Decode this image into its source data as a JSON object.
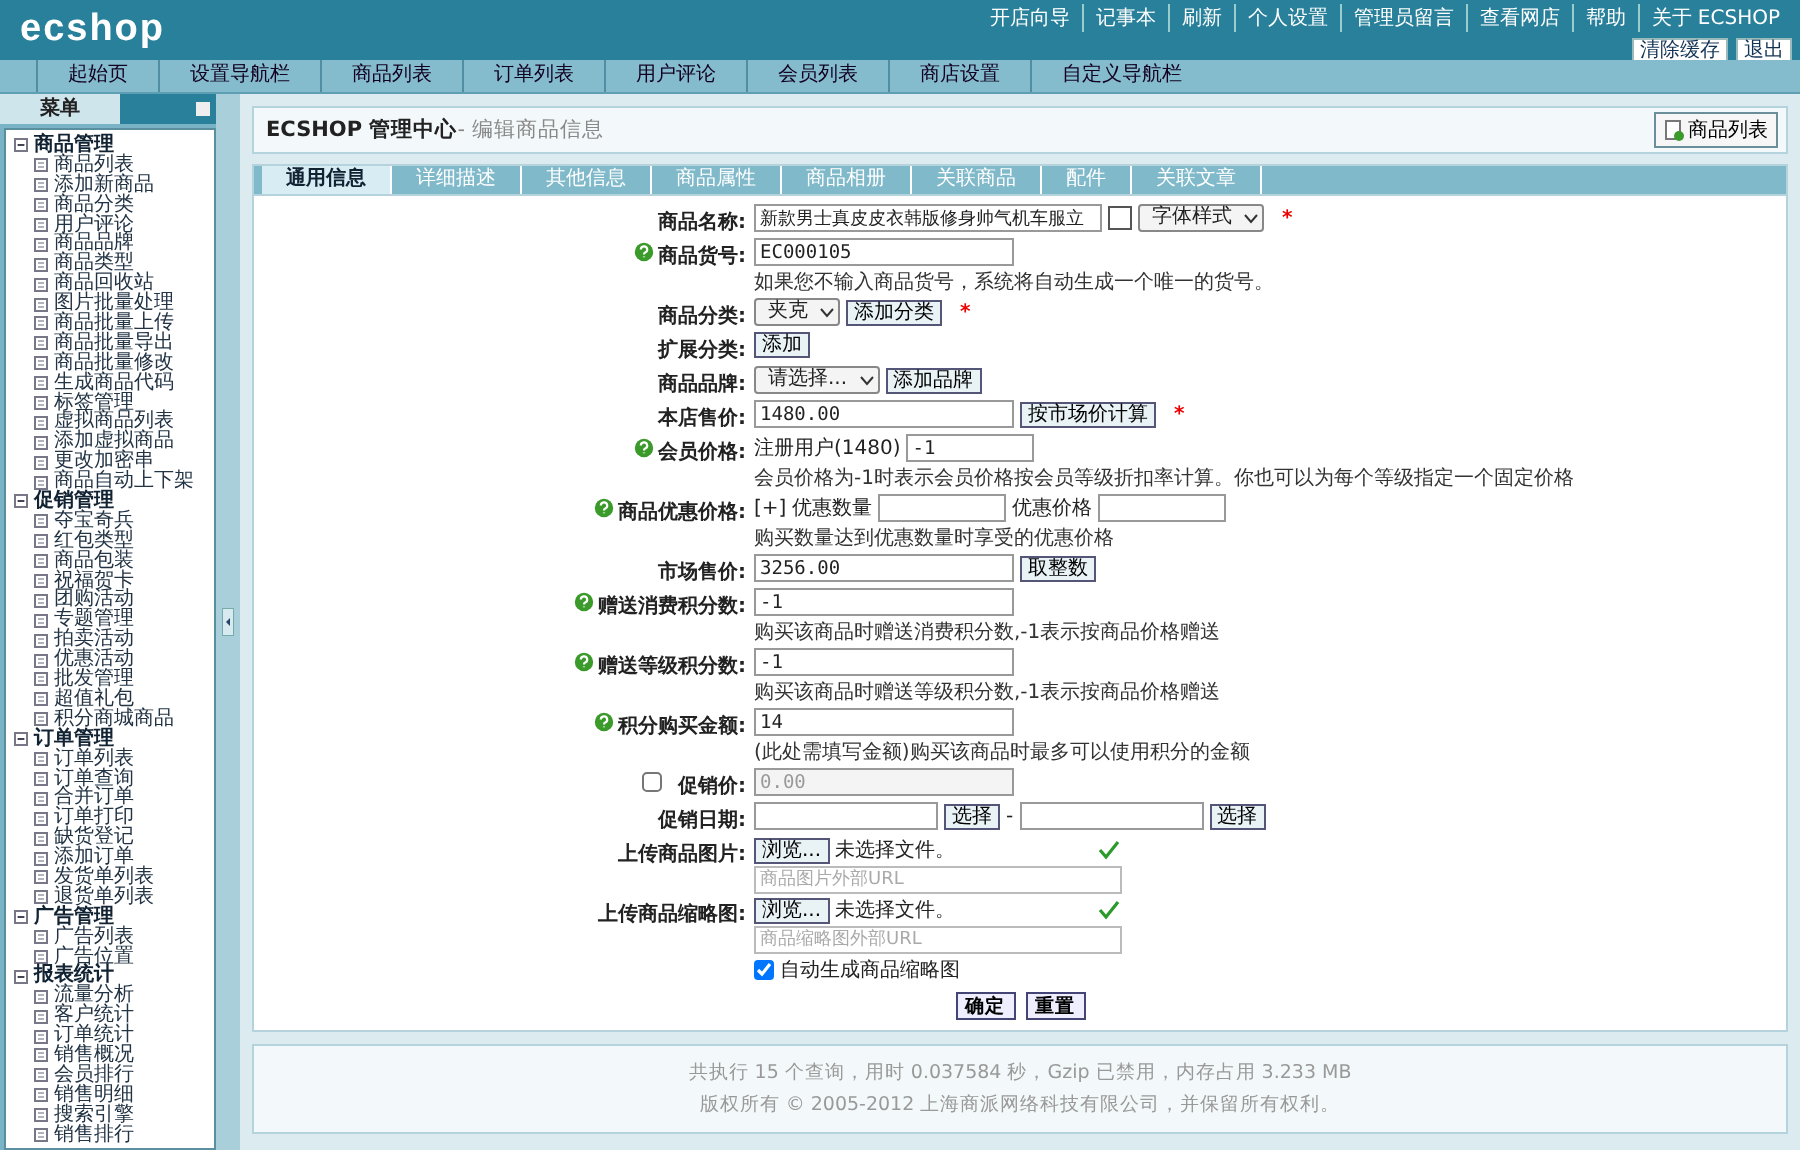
{
  "header": {
    "logo": "ecshop",
    "links": [
      "开店向导",
      "记事本",
      "刷新",
      "个人设置",
      "管理员留言",
      "查看网店",
      "帮助",
      "关于 ECSHOP"
    ],
    "buttons": [
      "清除缓存",
      "退出"
    ]
  },
  "nav": {
    "tabs": [
      {
        "label": "起始页",
        "selected": false
      },
      {
        "label": "设置导航栏",
        "selected": false
      },
      {
        "label": "商品列表",
        "selected": false
      },
      {
        "label": "订单列表",
        "selected": false
      },
      {
        "label": "用户评论",
        "selected": false
      },
      {
        "label": "会员列表",
        "selected": false
      },
      {
        "label": "商店设置",
        "selected": false
      },
      {
        "label": "自定义导航栏",
        "selected": false
      }
    ]
  },
  "sidebar": {
    "tab": "菜单",
    "groups": [
      {
        "label": "商品管理",
        "expanded": true,
        "children": [
          "商品列表",
          "添加新商品",
          "商品分类",
          "用户评论",
          "商品品牌",
          "商品类型",
          "商品回收站",
          "图片批量处理",
          "商品批量上传",
          "商品批量导出",
          "商品批量修改",
          "生成商品代码",
          "标签管理",
          "虚拟商品列表",
          "添加虚拟商品",
          "更改加密串",
          "商品自动上下架"
        ]
      },
      {
        "label": "促销管理",
        "expanded": true,
        "children": [
          "夺宝奇兵",
          "红包类型",
          "商品包装",
          "祝福贺卡",
          "团购活动",
          "专题管理",
          "拍卖活动",
          "优惠活动",
          "批发管理",
          "超值礼包",
          "积分商城商品"
        ]
      },
      {
        "label": "订单管理",
        "expanded": true,
        "children": [
          "订单列表",
          "订单查询",
          "合并订单",
          "订单打印",
          "缺货登记",
          "添加订单",
          "发货单列表",
          "退货单列表"
        ]
      },
      {
        "label": "广告管理",
        "expanded": true,
        "children": [
          "广告列表",
          "广告位置"
        ]
      },
      {
        "label": "报表统计",
        "expanded": true,
        "children": [
          "流量分析",
          "客户统计",
          "订单统计",
          "销售概况",
          "会员排行",
          "销售明细",
          "搜索引擎",
          "销售排行"
        ]
      }
    ]
  },
  "page": {
    "title": "ECSHOP 管理中心",
    "subtitle": "- 编辑商品信息",
    "action": "商品列表"
  },
  "tabs": [
    {
      "label": "通用信息",
      "selected": true
    },
    {
      "label": "详细描述",
      "selected": false
    },
    {
      "label": "其他信息",
      "selected": false
    },
    {
      "label": "商品属性",
      "selected": false
    },
    {
      "label": "商品相册",
      "selected": false
    },
    {
      "label": "关联商品",
      "selected": false
    },
    {
      "label": "配件",
      "selected": false
    },
    {
      "label": "关联文章",
      "selected": false
    }
  ],
  "form": {
    "rows": [
      {
        "label": "商品名称:",
        "lines": [
          [
            {
              "kind": "input-wide",
              "value": "新款男士真皮皮衣韩版修身帅气机车服立"
            },
            {
              "kind": "color"
            },
            {
              "kind": "select",
              "value": "字体样式"
            },
            {
              "kind": "required",
              "text": "*"
            }
          ]
        ]
      },
      {
        "label": "商品货号:",
        "help": true,
        "lines": [
          [
            {
              "kind": "input",
              "value": "EC000105"
            }
          ],
          [
            {
              "kind": "note",
              "text": "如果您不输入商品货号，系统将自动生成一个唯一的货号。"
            }
          ]
        ]
      },
      {
        "label": "商品分类:",
        "lines": [
          [
            {
              "kind": "select",
              "value": "夹克"
            },
            {
              "kind": "button",
              "text": "添加分类"
            },
            {
              "kind": "required",
              "text": "*"
            }
          ]
        ]
      },
      {
        "label": "扩展分类:",
        "lines": [
          [
            {
              "kind": "button",
              "text": "添加"
            }
          ]
        ]
      },
      {
        "label": "商品品牌:",
        "lines": [
          [
            {
              "kind": "select",
              "value": "请选择..."
            },
            {
              "kind": "button",
              "text": "添加品牌"
            }
          ]
        ]
      },
      {
        "label": "本店售价:",
        "lines": [
          [
            {
              "kind": "input",
              "value": "1480.00"
            },
            {
              "kind": "button",
              "text": "按市场价计算"
            },
            {
              "kind": "required",
              "text": "*"
            }
          ]
        ]
      },
      {
        "label": "会员价格:",
        "help": true,
        "lines": [
          [
            {
              "kind": "text",
              "text": "注册用户(1480)"
            },
            {
              "kind": "input-short",
              "value": "-1"
            }
          ],
          [
            {
              "kind": "note",
              "text": "会员价格为-1时表示会员价格按会员等级折扣率计算。你也可以为每个等级指定一个固定价格"
            }
          ]
        ]
      },
      {
        "label": "商品优惠价格:",
        "help": true,
        "lines": [
          [
            {
              "kind": "text",
              "text": "[+]"
            },
            {
              "kind": "text",
              "text": "优惠数量"
            },
            {
              "kind": "input-short"
            },
            {
              "kind": "text",
              "text": "优惠价格"
            },
            {
              "kind": "input-short"
            }
          ],
          [
            {
              "kind": "note",
              "text": "购买数量达到优惠数量时享受的优惠价格"
            }
          ]
        ]
      },
      {
        "label": "市场售价:",
        "lines": [
          [
            {
              "kind": "input",
              "value": "3256.00"
            },
            {
              "kind": "button",
              "text": "取整数"
            }
          ]
        ]
      },
      {
        "label": "赠送消费积分数:",
        "help": true,
        "lines": [
          [
            {
              "kind": "input",
              "value": "-1"
            }
          ],
          [
            {
              "kind": "note",
              "text": "购买该商品时赠送消费积分数,-1表示按商品价格赠送"
            }
          ]
        ]
      },
      {
        "label": "赠送等级积分数:",
        "help": true,
        "lines": [
          [
            {
              "kind": "input",
              "value": "-1"
            }
          ],
          [
            {
              "kind": "note",
              "text": "购买该商品时赠送等级积分数,-1表示按商品价格赠送"
            }
          ]
        ]
      },
      {
        "label": "积分购买金额:",
        "help": true,
        "lines": [
          [
            {
              "kind": "input",
              "value": "14"
            }
          ],
          [
            {
              "kind": "note",
              "text": "(此处需填写金额)购买该商品时最多可以使用积分的金额"
            }
          ]
        ]
      },
      {
        "label": "促销价:",
        "checkbox": {
          "checked": false
        },
        "lines": [
          [
            {
              "kind": "input",
              "value": "0.00",
              "disabled": true
            }
          ]
        ]
      },
      {
        "label": "促销日期:",
        "lines": [
          [
            {
              "kind": "input-date"
            },
            {
              "kind": "button",
              "text": "选择"
            },
            {
              "kind": "text",
              "text": "-"
            },
            {
              "kind": "input-date"
            },
            {
              "kind": "button",
              "text": "选择"
            }
          ]
        ]
      },
      {
        "label": "上传商品图片:",
        "lines": [
          [
            {
              "kind": "file",
              "button": "浏览...",
              "text": "未选择文件。"
            },
            {
              "kind": "check"
            }
          ],
          [
            {
              "kind": "url",
              "placeholder": "商品图片外部URL"
            }
          ]
        ]
      },
      {
        "label": "上传商品缩略图:",
        "lines": [
          [
            {
              "kind": "file",
              "button": "浏览...",
              "text": "未选择文件。"
            },
            {
              "kind": "check"
            }
          ],
          [
            {
              "kind": "url",
              "placeholder": "商品缩略图外部URL"
            }
          ],
          [
            {
              "kind": "checkbox",
              "checked": true,
              "text": "自动生成商品缩略图"
            }
          ]
        ]
      }
    ],
    "buttons": [
      "确定",
      "重置"
    ]
  },
  "footer": {
    "lines": [
      "共执行 15 个查询，用时 0.037584 秒，Gzip 已禁用，内存占用 3.233 MB",
      "版权所有 © 2005-2012 上海商派网络科技有限公司，并保留所有权利。"
    ]
  }
}
